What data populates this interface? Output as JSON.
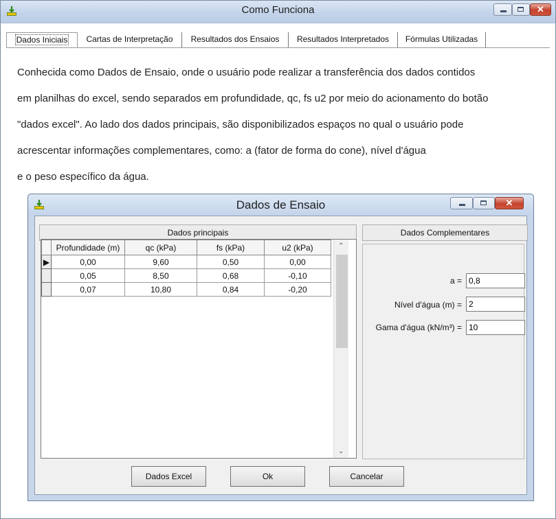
{
  "window": {
    "title": "Como Funciona"
  },
  "tabs": [
    {
      "label": "Dados Iniciais"
    },
    {
      "label": "Cartas de Interpretação"
    },
    {
      "label": "Resultados dos Ensaios"
    },
    {
      "label": "Resultados Interpretados"
    },
    {
      "label": "Fórmulas Utilizadas"
    }
  ],
  "description": [
    "Conhecida como Dados de Ensaio, onde o usuário pode realizar a transferência dos dados contidos",
    "em planilhas do excel, sendo separados em profundidade, qc, fs u2 por meio do acionamento do botão",
    "\"dados excel\". Ao lado dos dados principais, são disponibilizados espaços no qual o usuário pode",
    "acrescentar informações complementares, como: a (fator de forma do cone), nível d'água",
    "e o peso específico da água."
  ],
  "dialog": {
    "title": "Dados de Ensaio",
    "main_group": "Dados principais",
    "compl_group": "Dados Complementares",
    "columns": [
      "Profundidade (m)",
      "qc (kPa)",
      "fs (kPa)",
      "u2 (kPa)"
    ],
    "rows": [
      [
        "0,00",
        "9,60",
        "0,50",
        "0,00"
      ],
      [
        "0,05",
        "8,50",
        "0,68",
        "-0,10"
      ],
      [
        "0,07",
        "10,80",
        "0,84",
        "-0,20"
      ]
    ],
    "fields": {
      "a": {
        "label": "a =",
        "value": "0,8"
      },
      "nivel": {
        "label": "Nível d'água (m) =",
        "value": "2"
      },
      "gama": {
        "label": "Gama d'água (kN/m³) =",
        "value": "10"
      }
    },
    "buttons": {
      "excel": "Dados Excel",
      "ok": "Ok",
      "cancel": "Cancelar"
    }
  },
  "colors": {
    "titlebar": "#c8d8ee",
    "close": "#c4432e"
  }
}
